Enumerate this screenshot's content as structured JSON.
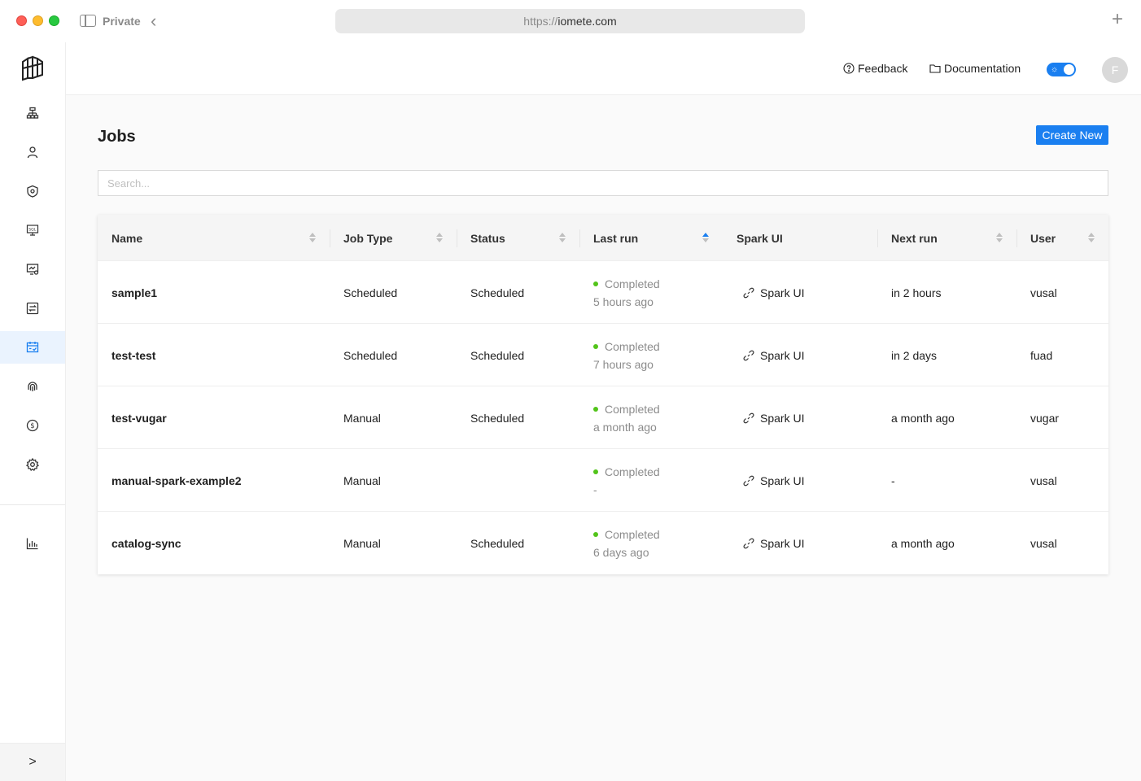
{
  "browser": {
    "private_label": "Private",
    "url_scheme": "https://",
    "url_host": "iomete.com"
  },
  "header": {
    "feedback_label": "Feedback",
    "documentation_label": "Documentation",
    "avatar_initial": "F"
  },
  "page": {
    "title": "Jobs",
    "create_button_label": "Create New",
    "search_placeholder": "Search..."
  },
  "table": {
    "columns": [
      "Name",
      "Job Type",
      "Status",
      "Last run",
      "Spark UI",
      "Next run",
      "User"
    ],
    "sorted_column": "Last run",
    "sort_direction": "ascending",
    "rows": [
      {
        "name": "sample1",
        "job_type": "Scheduled",
        "status": "Scheduled",
        "last_run_status": "Completed",
        "last_run_ago": "5 hours ago",
        "spark_ui": "Spark UI",
        "next_run": "in 2 hours",
        "user": "vusal"
      },
      {
        "name": "test-test",
        "job_type": "Scheduled",
        "status": "Scheduled",
        "last_run_status": "Completed",
        "last_run_ago": "7 hours ago",
        "spark_ui": "Spark UI",
        "next_run": "in 2 days",
        "user": "fuad"
      },
      {
        "name": "test-vugar",
        "job_type": "Manual",
        "status": "Scheduled",
        "last_run_status": "Completed",
        "last_run_ago": "a month ago",
        "spark_ui": "Spark UI",
        "next_run": "a month ago",
        "user": "vugar"
      },
      {
        "name": "manual-spark-example2",
        "job_type": "Manual",
        "status": "",
        "last_run_status": "Completed",
        "last_run_ago": "-",
        "spark_ui": "Spark UI",
        "next_run": "-",
        "user": "vusal"
      },
      {
        "name": "catalog-sync",
        "job_type": "Manual",
        "status": "Scheduled",
        "last_run_status": "Completed",
        "last_run_ago": "6 days ago",
        "spark_ui": "Spark UI",
        "next_run": "a month ago",
        "user": "vusal"
      }
    ]
  },
  "nav": {
    "active_item": "jobs",
    "items": [
      "data-plane-icon",
      "user-icon",
      "security-shield-icon",
      "sql-editor-icon",
      "monitor-icon",
      "spark-icon",
      "jobs-calendar-icon",
      "fingerprint-icon",
      "billing-dollar-icon",
      "settings-gear-icon",
      "bar-chart-icon"
    ]
  },
  "colors": {
    "accent": "#1a7ff0",
    "success": "#52c41a"
  }
}
